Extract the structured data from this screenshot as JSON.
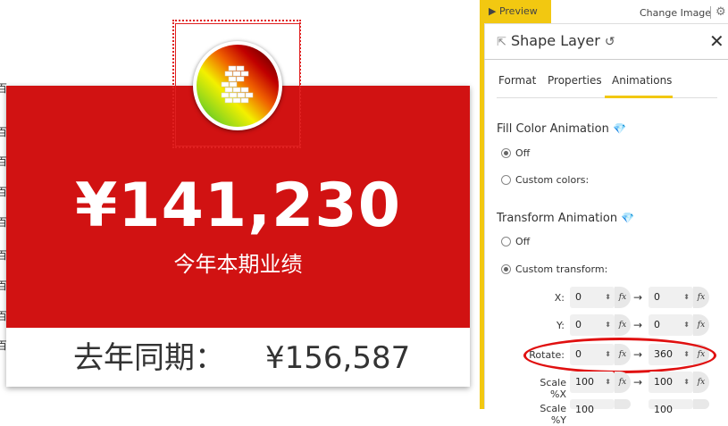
{
  "card": {
    "value": "¥141,230",
    "label": "今年本期业绩",
    "last_year_label": "去年同期：",
    "last_year_value": "¥156,587"
  },
  "edge_glyph": "百",
  "colors": {
    "card_red": "#d11212",
    "accent_yellow": "#f2c811",
    "highlight_red": "#e01010"
  },
  "toolbar": {
    "preview": "▶ Preview",
    "change_image": "Change Image"
  },
  "panel": {
    "title": "Shape Layer",
    "tabs": [
      {
        "label": "Format",
        "active": false
      },
      {
        "label": "Properties",
        "active": false
      },
      {
        "label": "Animations",
        "active": true
      }
    ],
    "fill_color": {
      "title": "Fill Color Animation",
      "options": [
        {
          "label": "Off",
          "selected": true
        },
        {
          "label": "Custom colors:",
          "selected": false
        }
      ]
    },
    "transform": {
      "title": "Transform Animation",
      "options": [
        {
          "label": "Off",
          "selected": false
        },
        {
          "label": "Custom transform:",
          "selected": true
        }
      ],
      "rows": [
        {
          "label": "X:",
          "from": "0",
          "to": "0"
        },
        {
          "label": "Y:",
          "from": "0",
          "to": "0"
        },
        {
          "label": "Rotate:",
          "from": "0",
          "to": "360"
        },
        {
          "label": "Scale %X",
          "from": "100",
          "to": "100"
        },
        {
          "label": "Scale %Y",
          "from": "100",
          "to": "100"
        }
      ]
    }
  }
}
